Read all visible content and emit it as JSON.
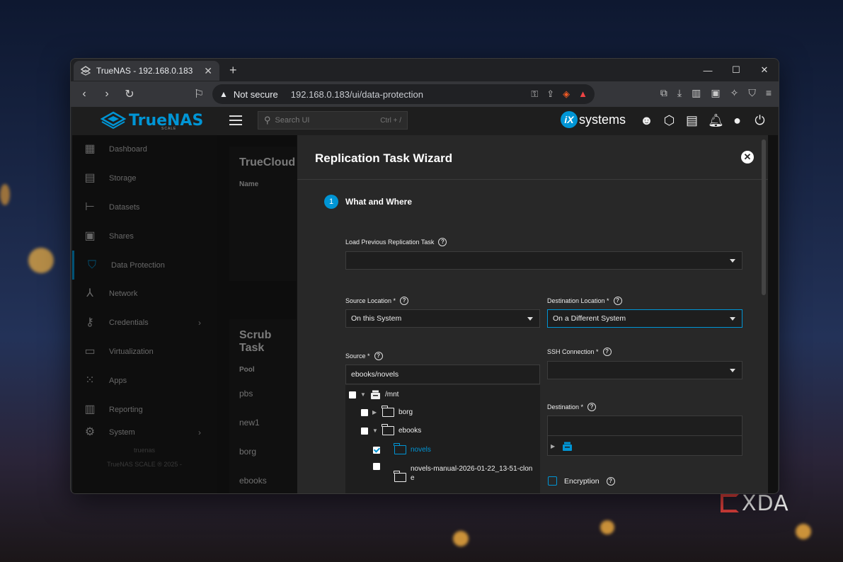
{
  "browser": {
    "tab_title": "TrueNAS - 192.168.0.183",
    "security_label": "Not secure",
    "url": "192.168.0.183/ui/data-protection"
  },
  "app": {
    "logo_text": "TrueNAS",
    "logo_subtitle": "SCALE",
    "search_placeholder": "Search UI",
    "search_shortcut": "Ctrl + /",
    "vendor_badge": "iX",
    "vendor_text": "systems"
  },
  "sidebar": {
    "items": [
      {
        "label": "Dashboard",
        "icon": "dashboard-icon"
      },
      {
        "label": "Storage",
        "icon": "storage-icon"
      },
      {
        "label": "Datasets",
        "icon": "datasets-icon"
      },
      {
        "label": "Shares",
        "icon": "shares-icon"
      },
      {
        "label": "Data Protection",
        "icon": "shield-icon"
      },
      {
        "label": "Network",
        "icon": "network-icon"
      },
      {
        "label": "Credentials",
        "icon": "key-icon"
      },
      {
        "label": "Virtualization",
        "icon": "monitor-icon"
      },
      {
        "label": "Apps",
        "icon": "apps-icon"
      },
      {
        "label": "Reporting",
        "icon": "chart-icon"
      },
      {
        "label": "System",
        "icon": "gear-icon"
      }
    ],
    "footer_host": "truenas",
    "footer_copy": "TrueNAS SCALE ® 2025 -"
  },
  "background_cards": {
    "cloud_title": "TrueCloud",
    "cloud_col": "Name",
    "scrub_title": "Scrub Task",
    "scrub_col": "Pool",
    "pools": [
      "pbs",
      "new1",
      "borg",
      "ebooks"
    ]
  },
  "wizard": {
    "title": "Replication Task Wizard",
    "step_number": "1",
    "step_label": "What and Where",
    "load_prev_label": "Load Previous Replication Task",
    "source_location_label": "Source Location *",
    "source_location_value": "On this System",
    "destination_location_label": "Destination Location *",
    "destination_location_value": "On a Different System",
    "source_label": "Source *",
    "source_value": "ebooks/novels",
    "ssh_label": "SSH Connection *",
    "destination_label": "Destination *",
    "encryption_label": "Encryption",
    "tree": {
      "root": "/mnt",
      "borg": "borg",
      "ebooks": "ebooks",
      "novels": "novels",
      "clone_line1": "novels-manual-2026-01-22_13-51-clon",
      "clone_line2": "e"
    }
  },
  "watermark": "XDA",
  "colors": {
    "accent": "#0095d5"
  }
}
